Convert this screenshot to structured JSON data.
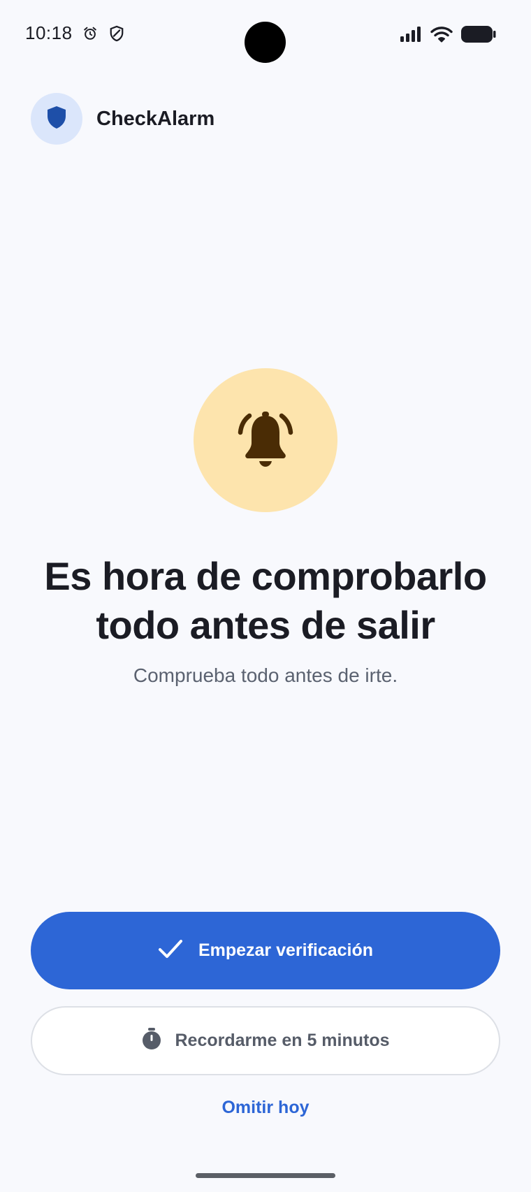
{
  "status_bar": {
    "time": "10:18",
    "left_icons": [
      "alarm-icon",
      "shield-status-icon"
    ],
    "right_icons": [
      "signal-icon",
      "wifi-icon",
      "battery-icon"
    ]
  },
  "app": {
    "name": "CheckAlarm",
    "logo_icon": "shield-icon"
  },
  "alert": {
    "icon": "bell-ringing-icon",
    "headline_line1": "Es hora de comprobarlo",
    "headline_line2": "todo antes de salir",
    "subtitle": "Comprueba todo antes de irte."
  },
  "actions": {
    "primary_label": "Empezar verificación",
    "primary_icon": "check-icon",
    "secondary_label": "Recordarme en 5 minutos",
    "secondary_icon": "timer-icon",
    "skip_label": "Omitir hoy"
  },
  "colors": {
    "background": "#f8f9fd",
    "primary": "#2d66d6",
    "bell_circle": "#fde4ad",
    "bell": "#4a2c05",
    "logo_circle": "#dbe6fb",
    "logo_shield": "#1e4fa8"
  }
}
